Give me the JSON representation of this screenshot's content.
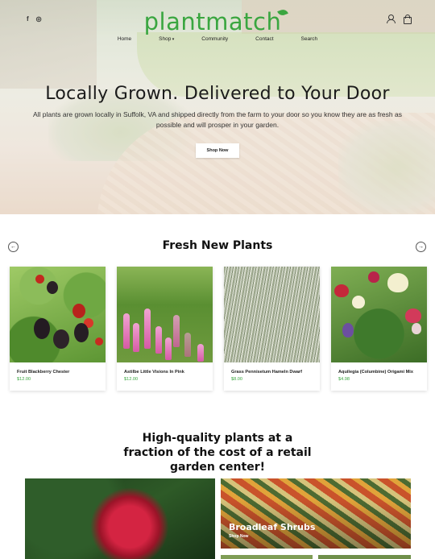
{
  "brand": {
    "logo_text": "plantmatch",
    "accent_color": "#3aa640"
  },
  "social": [
    {
      "icon": "facebook-icon",
      "glyph": "f"
    },
    {
      "icon": "instagram-icon",
      "glyph": "◎"
    }
  ],
  "nav": {
    "items": [
      "Home",
      "Shop",
      "Community",
      "Contact",
      "Search"
    ]
  },
  "hero": {
    "title": "Locally Grown. Delivered to Your Door",
    "subtitle": "All plants are grown locally in Suffolk, VA and shipped directly from the farm to your door so you know they are as fresh as possible and will prosper in your garden.",
    "button_label": "Shop Now"
  },
  "fresh": {
    "title": "Fresh New Plants",
    "prev_icon": "arrow-left-icon",
    "next_icon": "arrow-right-icon",
    "products": [
      {
        "name": "Fruit Blackberry Chester",
        "price": "$12.00"
      },
      {
        "name": "Astilbe Little Visions In Pink",
        "price": "$12.00"
      },
      {
        "name": "Grass Pennisetum Hameln Dwarf",
        "price": "$8.00"
      },
      {
        "name": "Aquilegia (Columbine) Origami Mix",
        "price": "$4.98"
      }
    ]
  },
  "quality": {
    "title": "High-quality plants at a fraction of the cost of a retail garden center!",
    "tiles": [
      {
        "label": "Broadleaf Shrubs",
        "link": "Shop Now"
      }
    ]
  }
}
